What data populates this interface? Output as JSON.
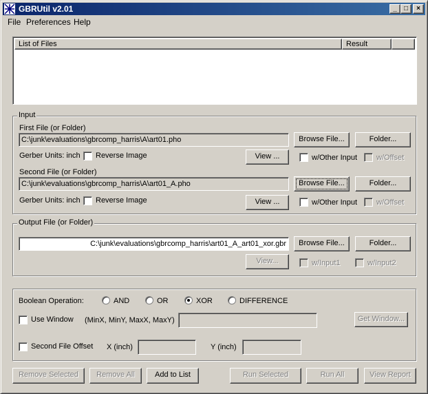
{
  "window": {
    "title": "GBRUtil v2.01"
  },
  "title_buttons": {
    "minimize": "_",
    "maximize": "□",
    "close": "×"
  },
  "menu": [
    "File",
    "Preferences",
    "Help"
  ],
  "file_list": {
    "col_files": "List of Files",
    "col_result": "Result"
  },
  "input": {
    "group_title": "Input",
    "first_label": "First File (or Folder)",
    "first_value": "C:\\junk\\evaluations\\gbrcomp_harris\\A\\art01.pho",
    "first_units": "Gerber Units: inch",
    "second_label": "Second File (or Folder)",
    "second_value": "C:\\junk\\evaluations\\gbrcomp_harris\\A\\art01_A.pho",
    "second_units": "Gerber Units: inch",
    "reverse_image": "Reverse Image",
    "browse_file": "Browse File...",
    "folder": "Folder...",
    "view": "View ...",
    "w_other_input": "w/Other Input",
    "w_offset": "w/Offset"
  },
  "output": {
    "group_title": "Output File (or Folder)",
    "value": "C:\\junk\\evaluations\\gbrcomp_harris\\art01_A_art01_xor.gbr",
    "browse_file": "Browse File...",
    "folder": "Folder...",
    "view": "View...",
    "w_input1": "w/Input1",
    "w_input2": "w/Input2"
  },
  "boolean": {
    "label": "Boolean Operation:",
    "options": [
      "AND",
      "OR",
      "XOR",
      "DIFFERENCE"
    ],
    "selected": "XOR",
    "use_window": "Use Window",
    "window_hint": "(MinX, MinY, MaxX, MaxY)",
    "get_window": "Get Window...",
    "second_offset": "Second File Offset",
    "x_label": "X (inch)",
    "y_label": "Y (inch)"
  },
  "bottom": {
    "remove_selected": "Remove Selected",
    "remove_all": "Remove All",
    "add_to_list": "Add to List",
    "run_selected": "Run Selected",
    "run_all": "Run All",
    "view_report": "View Report"
  }
}
